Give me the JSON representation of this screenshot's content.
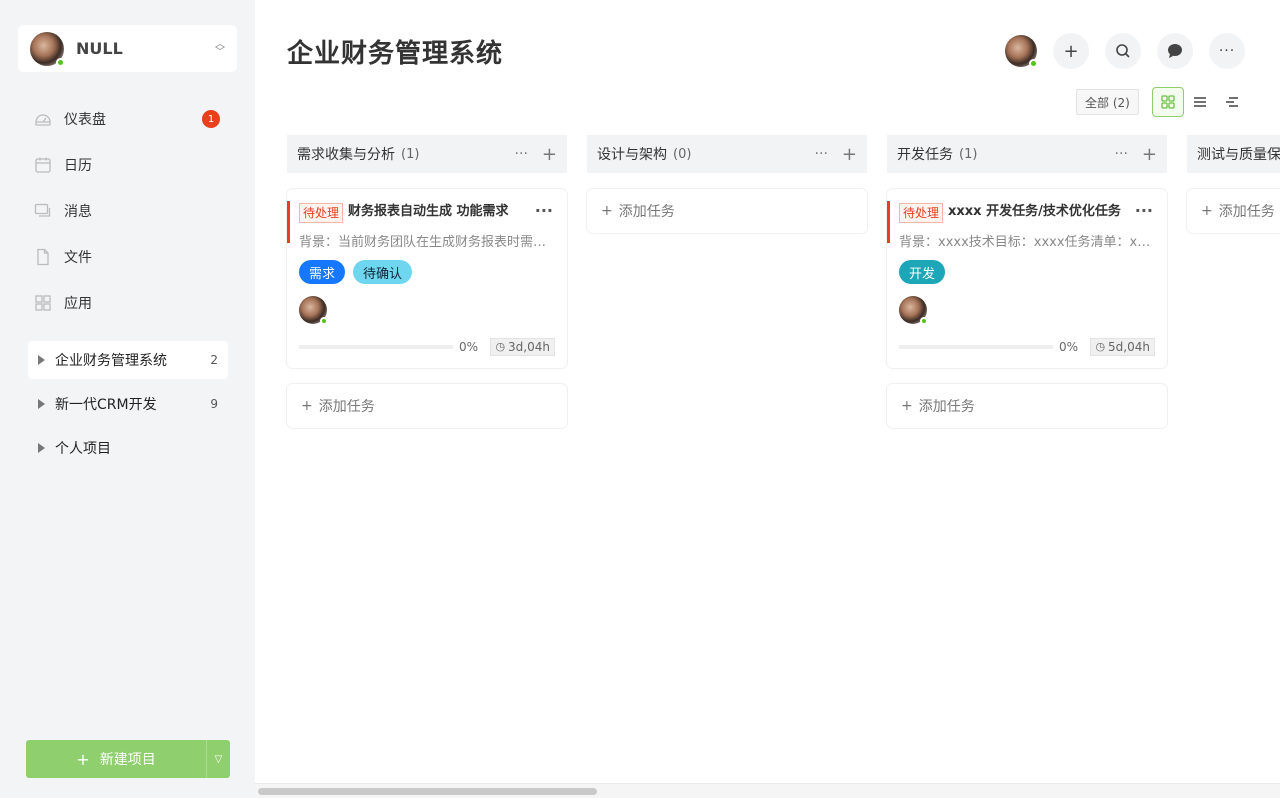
{
  "user": {
    "name": "NULL"
  },
  "nav": [
    {
      "label": "仪表盘",
      "icon": "dashboard-icon",
      "badge": "1"
    },
    {
      "label": "日历",
      "icon": "calendar-icon"
    },
    {
      "label": "消息",
      "icon": "message-icon"
    },
    {
      "label": "文件",
      "icon": "file-icon"
    },
    {
      "label": "应用",
      "icon": "apps-icon"
    }
  ],
  "projects": [
    {
      "label": "企业财务管理系统",
      "count": "2",
      "active": true
    },
    {
      "label": "新一代CRM开发",
      "count": "9"
    },
    {
      "label": "个人项目",
      "count": ""
    }
  ],
  "new_project": {
    "label": "新建项目"
  },
  "page": {
    "title": "企业财务管理系统"
  },
  "filter": {
    "label": "全部 (2)"
  },
  "colors": {
    "accent": "#8fcf6e",
    "danger": "#e8401c",
    "blue_tag": "#1677ff",
    "cyan_tag": "#6fd6ef",
    "teal_tag": "#1ca6b8"
  },
  "board": {
    "add_task": "添加任务",
    "columns": [
      {
        "title": "需求收集与分析",
        "count": "(1)"
      },
      {
        "title": "设计与架构",
        "count": "(0)"
      },
      {
        "title": "开发任务",
        "count": "(1)"
      },
      {
        "title": "测试与质量保",
        "count": ""
      }
    ],
    "cards": [
      {
        "status": "待处理",
        "title": "财务报表自动生成  功能需求",
        "desc": "背景：当前财务团队在生成财务报表时需要手动整理数据",
        "tags": [
          "需求",
          "待确认"
        ],
        "progress": 0,
        "progress_label": "0%",
        "time": "3d,04h"
      },
      {
        "status": "待处理",
        "title": "xxxx  开发任务/技术优化任务",
        "desc": "背景：xxxx技术目标：xxxx任务清单：xxxx",
        "tags": [
          "开发"
        ],
        "progress": 0,
        "progress_label": "0%",
        "time": "5d,04h"
      }
    ]
  }
}
